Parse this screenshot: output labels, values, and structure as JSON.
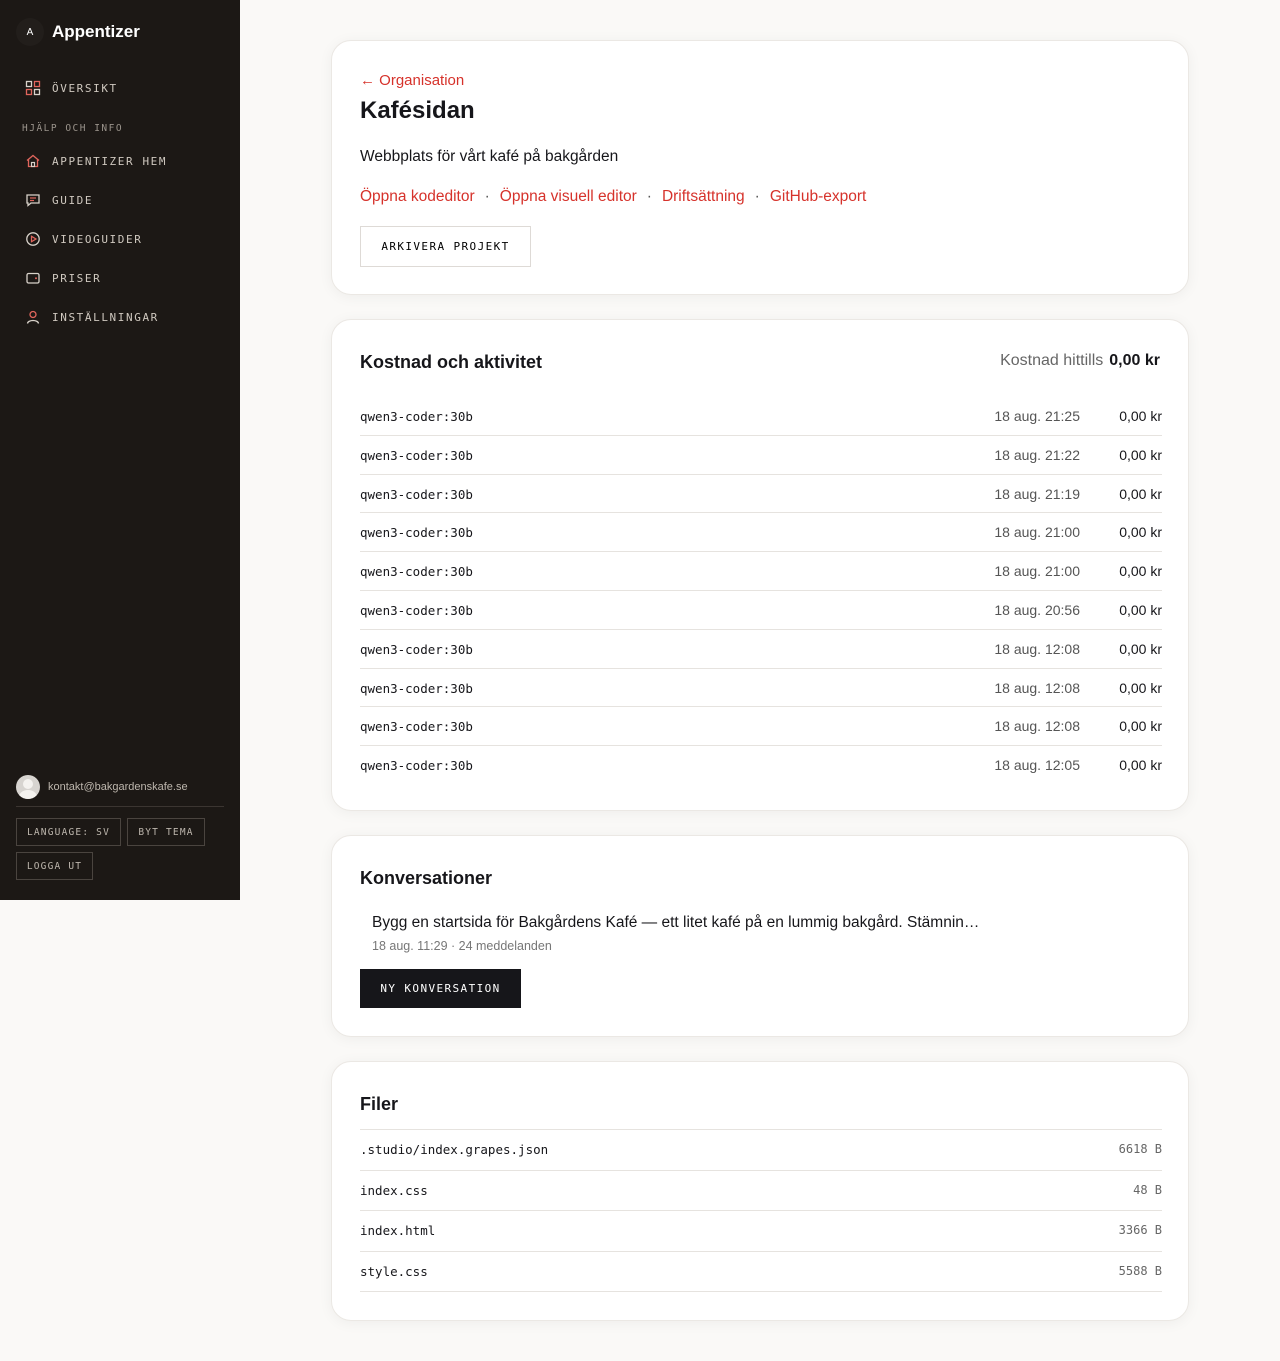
{
  "sidebar": {
    "brand": {
      "mark": "A",
      "name": "Appentizer"
    },
    "overview_label": "ÖVERSIKT",
    "section_label": "HJÄLP OCH INFO",
    "items": [
      {
        "label": "APPENTIZER HEM",
        "icon": "home-icon"
      },
      {
        "label": "GUIDE",
        "icon": "chat-icon"
      },
      {
        "label": "VIDEOGUIDER",
        "icon": "play-icon"
      },
      {
        "label": "PRISER",
        "icon": "wallet-icon"
      },
      {
        "label": "INSTÄLLNINGAR",
        "icon": "user-icon"
      }
    ],
    "account_email": "kontakt@bakgardenskafe.se",
    "language_label": "LANGUAGE: SV",
    "theme_label": "BYT TEMA",
    "logout_label": "LOGGA UT"
  },
  "project": {
    "back_label": "← Organisation",
    "title": "Kafésidan",
    "description": "Webbplats för vårt kafé på bakgården",
    "actions": [
      "Öppna kodeditor",
      "Öppna visuell editor",
      "Driftsättning",
      "GitHub-export"
    ],
    "separator": "·",
    "archive_label": "ARKIVERA PROJEKT"
  },
  "costs": {
    "title": "Kostnad och aktivitet",
    "total_label": "Kostnad hittills",
    "total_value": "0,00 kr",
    "rows": [
      {
        "model": "qwen3-coder:30b",
        "time": "18 aug. 21:25",
        "amount": "0,00 kr"
      },
      {
        "model": "qwen3-coder:30b",
        "time": "18 aug. 21:22",
        "amount": "0,00 kr"
      },
      {
        "model": "qwen3-coder:30b",
        "time": "18 aug. 21:19",
        "amount": "0,00 kr"
      },
      {
        "model": "qwen3-coder:30b",
        "time": "18 aug. 21:00",
        "amount": "0,00 kr"
      },
      {
        "model": "qwen3-coder:30b",
        "time": "18 aug. 21:00",
        "amount": "0,00 kr"
      },
      {
        "model": "qwen3-coder:30b",
        "time": "18 aug. 20:56",
        "amount": "0,00 kr"
      },
      {
        "model": "qwen3-coder:30b",
        "time": "18 aug. 12:08",
        "amount": "0,00 kr"
      },
      {
        "model": "qwen3-coder:30b",
        "time": "18 aug. 12:08",
        "amount": "0,00 kr"
      },
      {
        "model": "qwen3-coder:30b",
        "time": "18 aug. 12:08",
        "amount": "0,00 kr"
      },
      {
        "model": "qwen3-coder:30b",
        "time": "18 aug. 12:05",
        "amount": "0,00 kr"
      }
    ]
  },
  "conversations": {
    "title": "Konversationer",
    "items": [
      {
        "title": "Bygg en startsida för Bakgårdens Kafé — ett litet kafé på en lummig bakgård. Stämnin…",
        "meta": "18 aug. 11:29 · 24 meddelanden"
      }
    ],
    "new_label": "NY KONVERSATION"
  },
  "files": {
    "title": "Filer",
    "items": [
      {
        "name": ".studio/index.grapes.json",
        "size": "6618 B"
      },
      {
        "name": "index.css",
        "size": "48 B"
      },
      {
        "name": "index.html",
        "size": "3366 B"
      },
      {
        "name": "style.css",
        "size": "5588 B"
      }
    ]
  },
  "colors": {
    "accent": "#d6322b",
    "sidebar_bg": "#1c1815",
    "dark_button": "#16161a"
  }
}
